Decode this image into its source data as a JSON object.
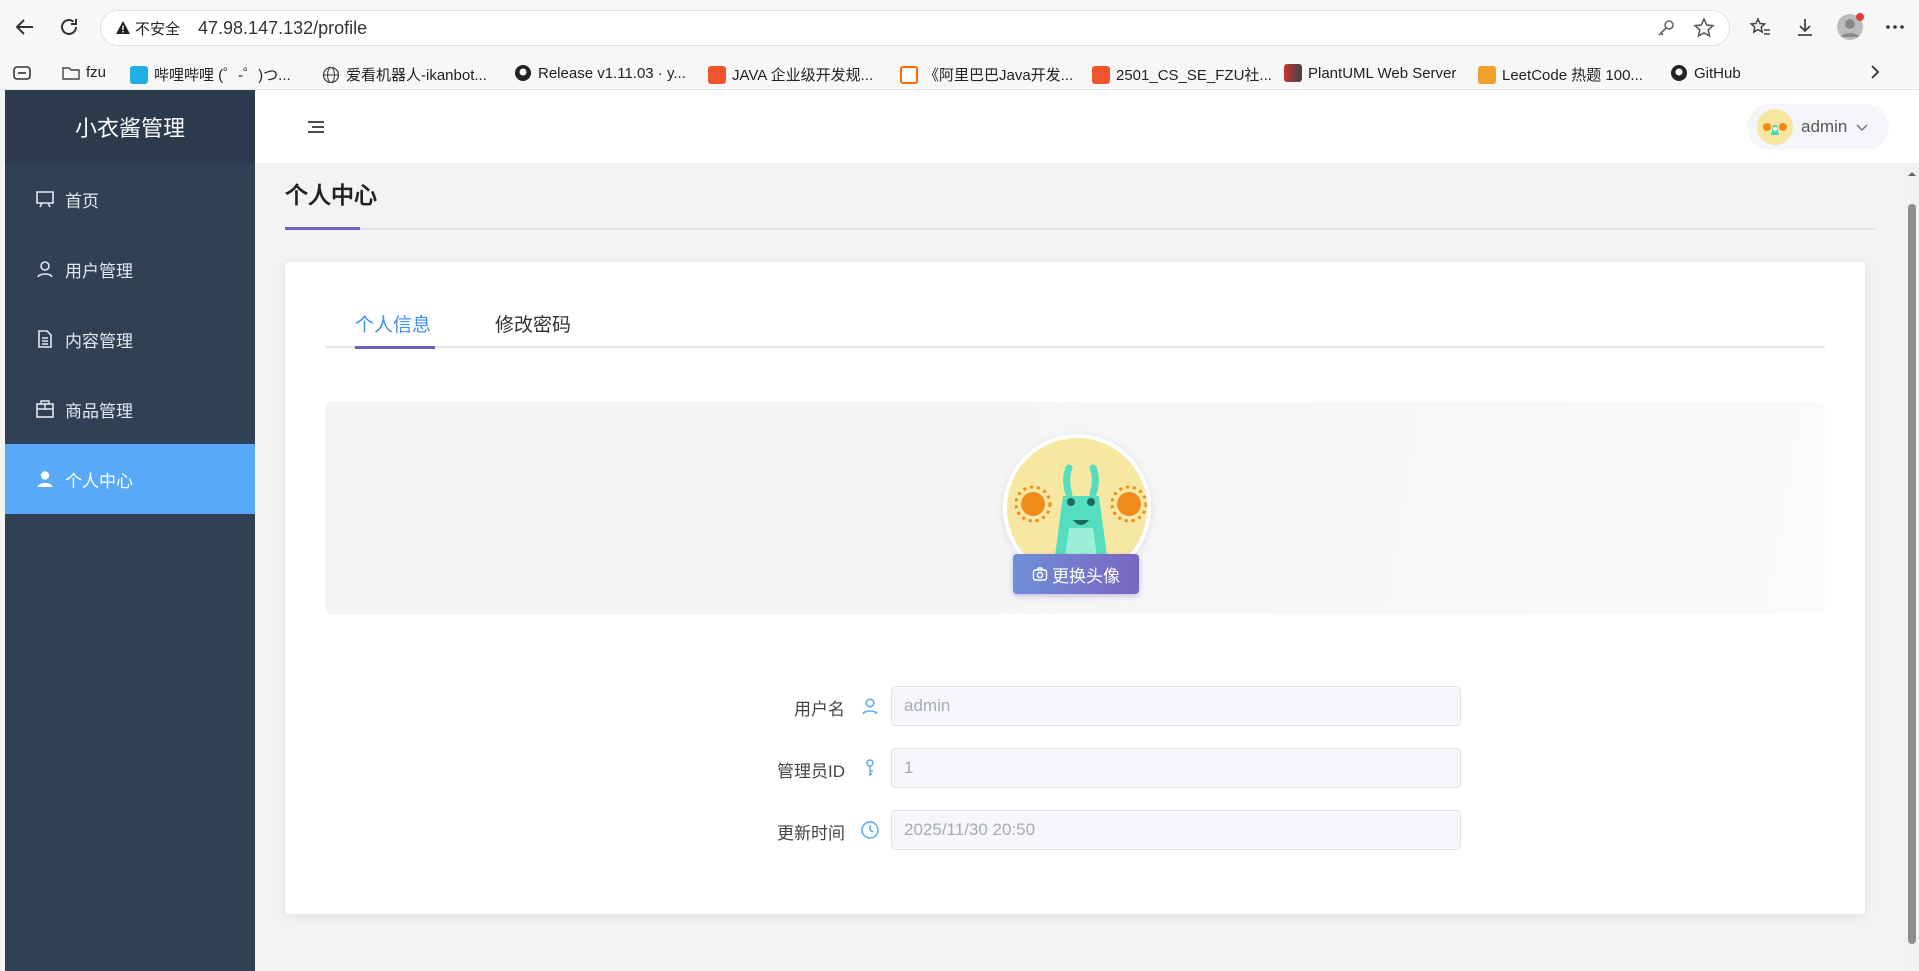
{
  "browser": {
    "security_label": "不安全",
    "url": "47.98.147.132/profile"
  },
  "bookmarks": [
    {
      "label": "fzu"
    },
    {
      "label": "哔哩哔哩 (゜-゜)つ..."
    },
    {
      "label": "爱看机器人-ikanbot..."
    },
    {
      "label": "Release v1.11.03 · y..."
    },
    {
      "label": "JAVA 企业级开发规..."
    },
    {
      "label": "《阿里巴巴Java开发..."
    },
    {
      "label": "2501_CS_SE_FZU社..."
    },
    {
      "label": "PlantUML Web Server"
    },
    {
      "label": "LeetCode 热题 100..."
    },
    {
      "label": "GitHub"
    }
  ],
  "sidebar": {
    "title": "小衣酱管理",
    "items": [
      {
        "label": "首页"
      },
      {
        "label": "用户管理"
      },
      {
        "label": "内容管理"
      },
      {
        "label": "商品管理"
      },
      {
        "label": "个人中心"
      }
    ]
  },
  "header": {
    "username": "admin"
  },
  "page": {
    "title": "个人中心",
    "tabs": [
      {
        "label": "个人信息"
      },
      {
        "label": "修改密码"
      }
    ],
    "change_avatar_label": "更换头像"
  },
  "form": {
    "username_label": "用户名",
    "username_value": "admin",
    "admin_id_label": "管理员ID",
    "admin_id_value": "1",
    "updated_label": "更新时间",
    "updated_value": "2025/11/30 20:50"
  },
  "colors": {
    "sidebar_bg": "#304156",
    "active_menu": "#5aa9f8",
    "accent": "#6c5fc7",
    "tab_active": "#3f8ff0"
  }
}
